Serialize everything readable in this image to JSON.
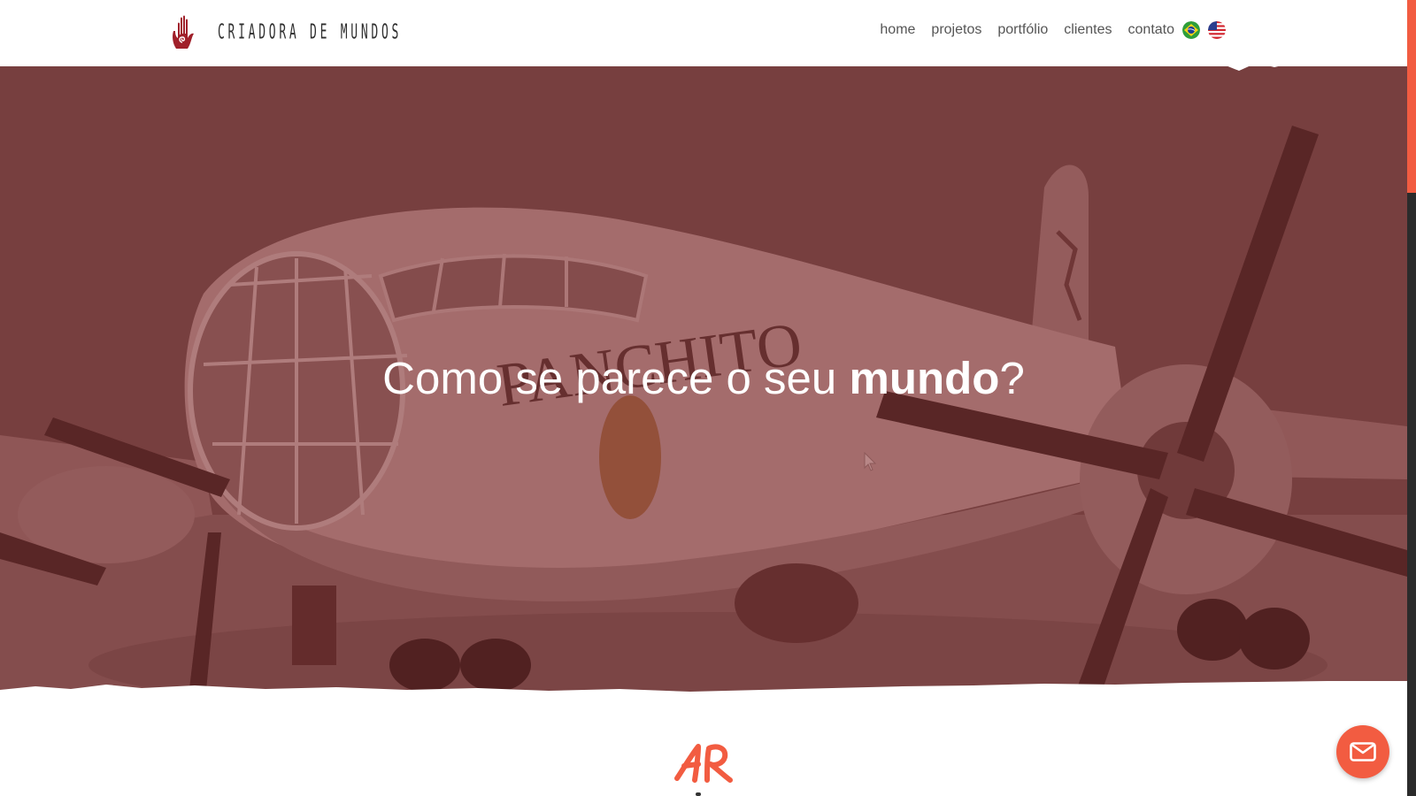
{
  "brand": {
    "name": "CRIADORA DE MUNDOS",
    "accent_color": "#f25c41",
    "hand_color": "#a0202a"
  },
  "nav": {
    "items": [
      {
        "label": "home"
      },
      {
        "label": "projetos"
      },
      {
        "label": "portfólio"
      },
      {
        "label": "clientes"
      },
      {
        "label": "contato"
      }
    ],
    "languages": [
      {
        "icon": "brazil-flag-icon"
      },
      {
        "icon": "usa-flag-icon"
      }
    ]
  },
  "hero": {
    "heading_pre": "Como se parece o seu ",
    "heading_bold": "mundo",
    "heading_post": "?",
    "image_text": "PANCHITO",
    "overlay_color": "#7a3c3c"
  },
  "section": {
    "logo_icon": "ar-monogram-icon"
  },
  "contact_button": {
    "icon": "mail-icon"
  }
}
